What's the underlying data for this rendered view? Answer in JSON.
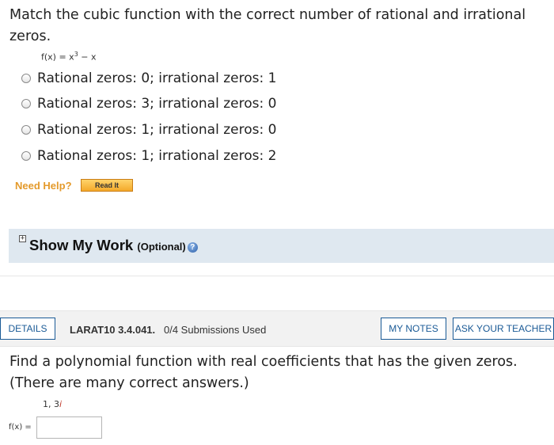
{
  "question1": {
    "text": "Match the cubic function with the correct number of rational and irrational zeros.",
    "function_prefix": "f(x) = x",
    "function_exponent": "3",
    "function_suffix": " − x",
    "options": [
      "Rational zeros: 0; irrational zeros: 1",
      "Rational zeros: 3; irrational zeros: 0",
      "Rational zeros: 1; irrational zeros: 0",
      "Rational zeros: 1; irrational zeros: 2"
    ],
    "need_help_label": "Need Help?",
    "read_it_label": "Read It"
  },
  "show_my_work": {
    "title": "Show My Work",
    "optional": "(Optional)",
    "expand_symbol": "+",
    "help_symbol": "?"
  },
  "question2": {
    "details_label": "DETAILS",
    "id": "LARAT10 3.4.041.",
    "submissions": "0/4 Submissions Used",
    "my_notes_label": "MY NOTES",
    "ask_teacher_label": "ASK YOUR TEACHER",
    "text": "Find a polynomial function with real coefficients that has the given zeros. (There are many correct answers.)",
    "zeros_prefix": "1, 3",
    "zeros_imag": "i",
    "answer_label": "f(x) =",
    "answer_value": ""
  }
}
